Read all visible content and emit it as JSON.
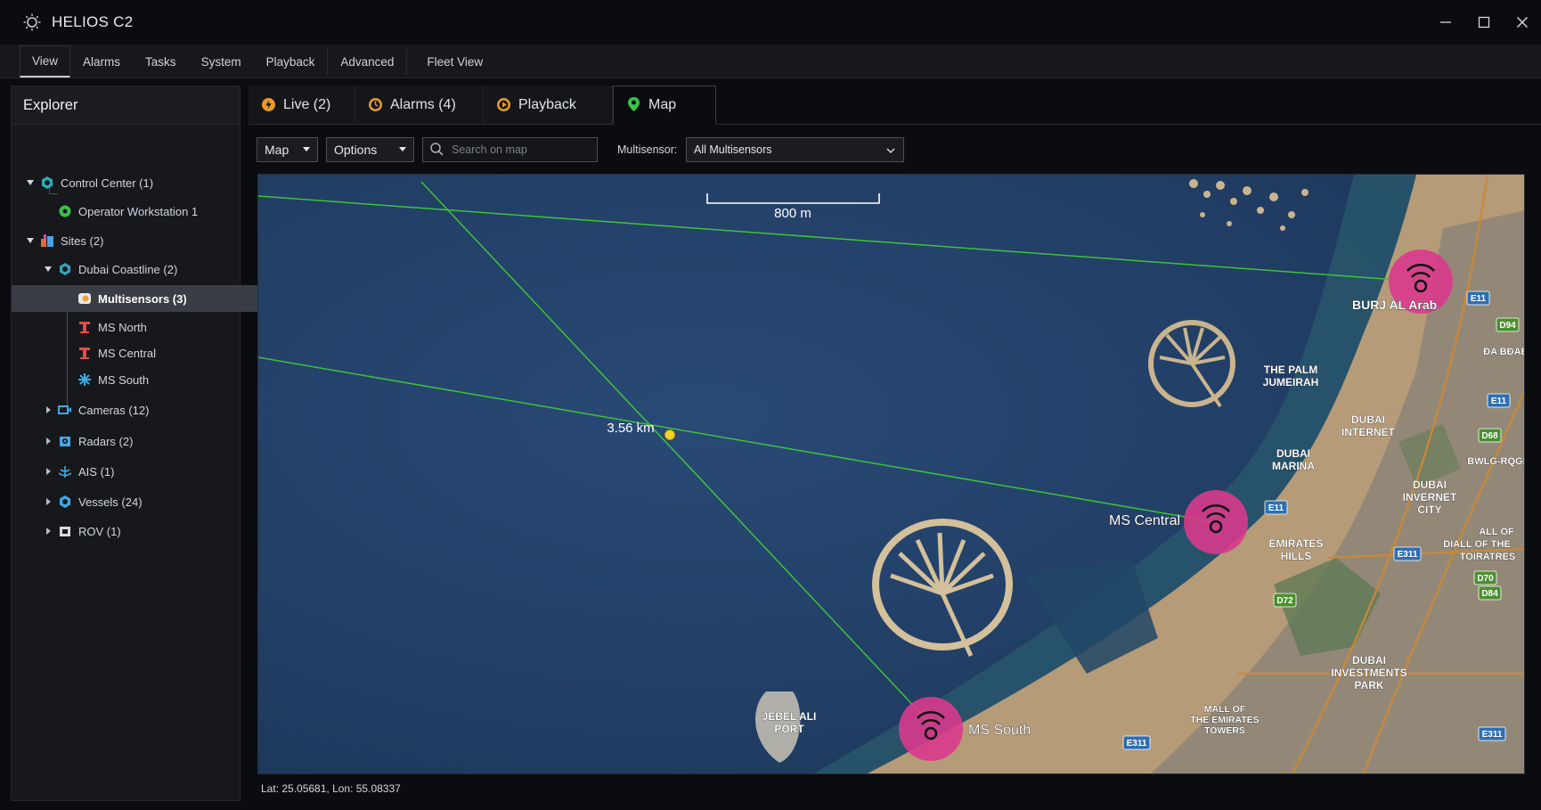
{
  "app": {
    "title": "HELIOS C2"
  },
  "menu": [
    "View",
    "Alarms",
    "Tasks",
    "System",
    "Playback",
    "Advanced",
    "Fleet View"
  ],
  "explorer": {
    "title": "Explorer",
    "control_center": "Control Center (1)",
    "operator_workstation": "Operator Workstation 1",
    "sites": "Sites (2)",
    "dubai_coastline": "Dubai Coastline (2)",
    "multisensors": "Multisensors (3)",
    "ms_north": "MS North",
    "ms_central": "MS Central",
    "ms_south": "MS South",
    "cameras": "Cameras (12)",
    "radars": "Radars (2)",
    "ais": "AIS (1)",
    "vessels": "Vessels (24)",
    "rov": "ROV (1)"
  },
  "tabs": {
    "live": "Live (2)",
    "alarms": "Alarms (4)",
    "playback": "Playback",
    "map": "Map"
  },
  "toolbar": {
    "view_select": "Map",
    "options_select": "Options",
    "search_placeholder": "Search on map",
    "multisensor_label": "Multisensor:",
    "multisensor_value": "All Multisensors"
  },
  "map": {
    "scale_label": "800 m",
    "distance_label": "3.56 km",
    "sensors": [
      "BURJ AL Arab",
      "MS Central",
      "MS South"
    ],
    "places": {
      "palm_jumeirah": [
        "THE PALM",
        "JUMEIRAH"
      ],
      "dubai_internet": [
        "DUBAI",
        "INTERNET"
      ],
      "dubai_marina": [
        "DUBAI",
        "MARINA"
      ],
      "dubai_investment_city": [
        "DUBAI",
        "INVERNET",
        "CITY"
      ],
      "emirates_hills": [
        "EMIRATES",
        "HILLS"
      ],
      "jebel_ali": [
        "JEBEL ALI",
        "PORT"
      ],
      "dubai_investments": [
        "DUBAI",
        "INVESTMENTS",
        "PARK"
      ],
      "mall_emirates": [
        "MALL OF",
        "THE EMIRATES",
        "TOWERS"
      ],
      "al_wasl": "ALL OF",
      "diall_towers": "DIALL OF THE",
      "toiratres": "TOIRATRES",
      "al_bada": "ĐA BĐAE",
      "bwlg": "BWLG-RQGI"
    },
    "road_badges": [
      "E11",
      "D94",
      "E11",
      "D68",
      "E11",
      "E311",
      "D72",
      "D70",
      "D84",
      "E311",
      "E311"
    ],
    "accent_line": "#3fc23a",
    "sensor_color": "#d93a8c",
    "target_color": "#f5d224"
  },
  "status": {
    "lat_lon": "Lat: 25.05681, Lon: 55.08337"
  }
}
